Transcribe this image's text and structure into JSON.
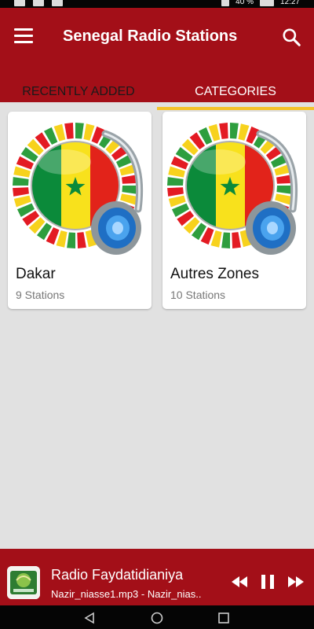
{
  "status_bar": {
    "battery": "40 %",
    "time": "12:27"
  },
  "app_bar": {
    "title": "Senegal Radio Stations"
  },
  "tabs": [
    {
      "label": "RECENTLY ADDED",
      "active": false
    },
    {
      "label": "CATEGORIES",
      "active": true
    }
  ],
  "categories": [
    {
      "name": "Dakar",
      "count": "9 Stations",
      "icon": "senegal-flag-headphones-icon"
    },
    {
      "name": "Autres Zones",
      "count": "10 Stations",
      "icon": "senegal-flag-headphones-icon"
    }
  ],
  "player": {
    "station": "Radio Faydatidianiya",
    "track": "Nazir_niasse1.mp3 - Nazir_nias..",
    "logo_icon": "station-logo-icon"
  },
  "colors": {
    "primary": "#a30f18",
    "accent": "#f4c22a",
    "background": "#e1e1e1"
  }
}
